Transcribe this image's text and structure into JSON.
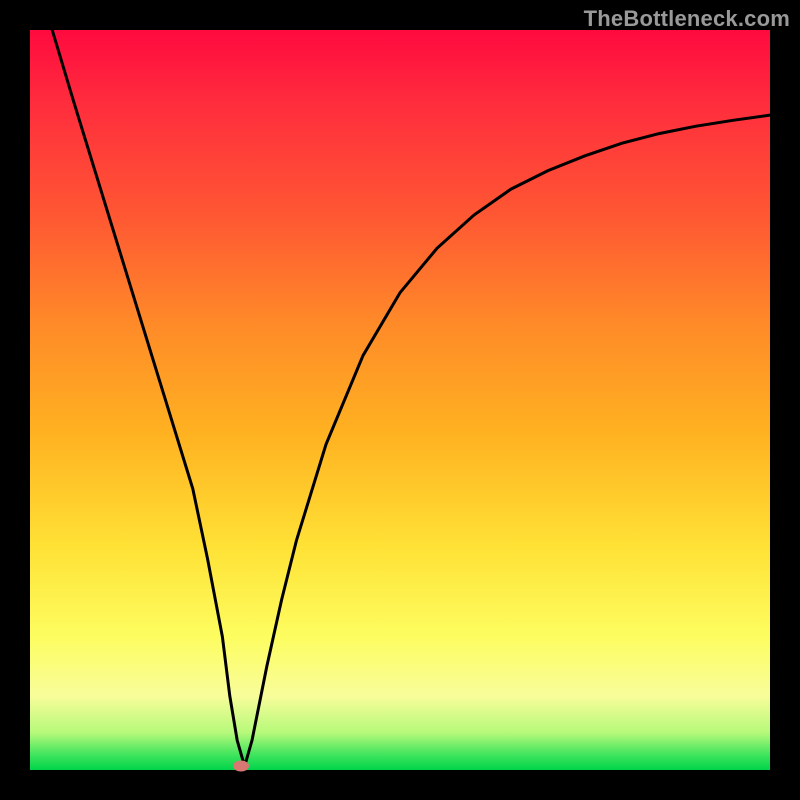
{
  "watermark": "TheBottleneck.com",
  "chart_data": {
    "type": "line",
    "title": "",
    "xlabel": "",
    "ylabel": "",
    "xlim": [
      0,
      100
    ],
    "ylim": [
      0,
      100
    ],
    "series": [
      {
        "name": "curve",
        "x": [
          3,
          6,
          10,
          14,
          18,
          22,
          24,
          26,
          27,
          28,
          29,
          30,
          32,
          34,
          36,
          40,
          45,
          50,
          55,
          60,
          65,
          70,
          75,
          80,
          85,
          90,
          95,
          100
        ],
        "y": [
          100,
          90,
          77,
          64,
          51,
          38,
          28.5,
          18,
          10,
          4,
          0.5,
          4,
          14,
          23,
          31,
          44,
          56,
          64.5,
          70.5,
          75,
          78.5,
          81,
          83,
          84.7,
          86,
          87,
          87.8,
          88.5
        ]
      }
    ],
    "marker": {
      "x": 28.5,
      "y": 0.5
    },
    "colors": {
      "curve": "#000000",
      "gradient_top": "#ff0a3f",
      "gradient_bottom": "#00d44a",
      "marker": "#d97773"
    }
  }
}
